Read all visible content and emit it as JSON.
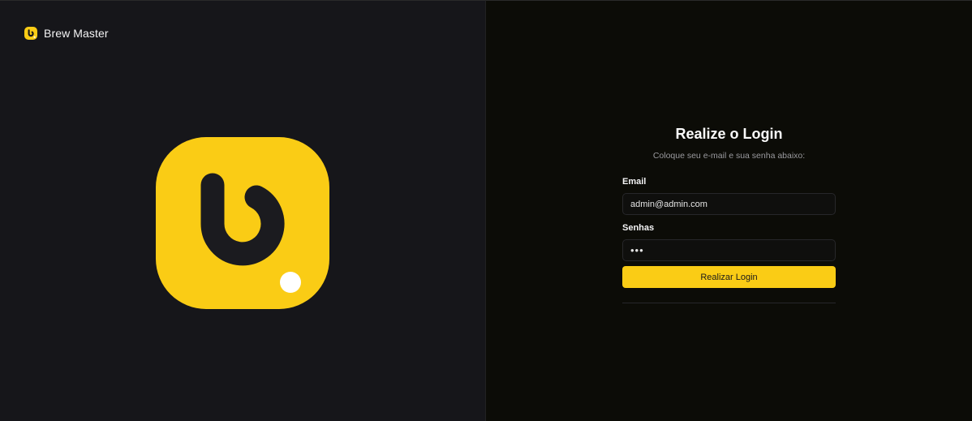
{
  "brand": {
    "name": "Brew Master",
    "icon": "brew-master-logo-icon",
    "accent_color": "#facc15"
  },
  "login": {
    "title": "Realize o Login",
    "subtitle": "Coloque seu e-mail e sua senha abaixo:",
    "email_label": "Email",
    "email_value": "admin@admin.com",
    "password_label": "Senhas",
    "password_value": "•••",
    "submit_label": "Realizar Login"
  },
  "colors": {
    "left_panel_bg": "#16161a",
    "right_panel_bg": "#0c0c07",
    "button_bg": "#facc15"
  }
}
